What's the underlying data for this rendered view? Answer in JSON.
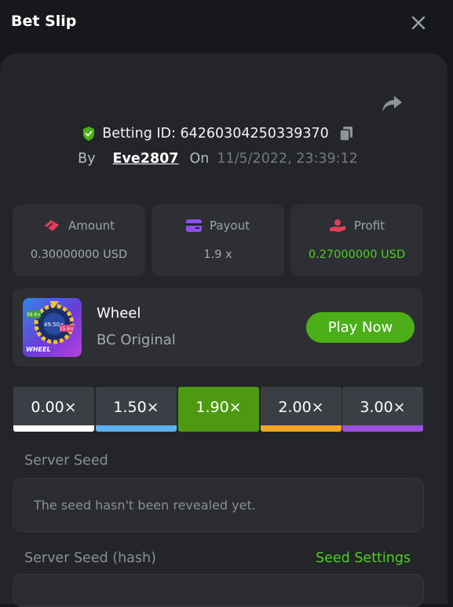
{
  "header": {
    "title": "Bet Slip",
    "close_icon": "close-icon"
  },
  "bet": {
    "betting_id_label": "Betting ID: 64260304250339370",
    "by_label": "By",
    "user": "Eve2807",
    "on_label": "On",
    "date": "11/5/2022, 23:39:12"
  },
  "stats": {
    "amount": {
      "label": "Amount",
      "value": "0.30000000 USD",
      "icon": "coins-icon"
    },
    "payout": {
      "label": "Payout",
      "value": "1.9 x",
      "icon": "wallet-icon"
    },
    "profit": {
      "label": "Profit",
      "value": "0.27000000 USD",
      "icon": "hand-coin-icon"
    }
  },
  "game": {
    "name": "Wheel",
    "subtitle": "BC Original",
    "play_label": "Play Now",
    "thumb_text": "WHEEL",
    "thumb_values": [
      "39.6×",
      "49.50×",
      "15.6×"
    ]
  },
  "multipliers": [
    {
      "label": "0.00×",
      "color": "#ffffff",
      "active": false
    },
    {
      "label": "1.50×",
      "color": "#5ab2f0",
      "active": false
    },
    {
      "label": "1.90×",
      "color": "#4d9a12",
      "active": true
    },
    {
      "label": "2.00×",
      "color": "#f3a624",
      "active": false
    },
    {
      "label": "3.00×",
      "color": "#9a50dc",
      "active": false
    }
  ],
  "server_seed": {
    "label": "Server Seed",
    "text": "The seed hasn't been revealed yet."
  },
  "server_seed_hash": {
    "label": "Server Seed (hash)",
    "settings_label": "Seed Settings"
  },
  "colors": {
    "accent_green": "#4caf19",
    "profit_green": "#4fcf1d",
    "background": "#17181b",
    "panel": "#232529"
  }
}
